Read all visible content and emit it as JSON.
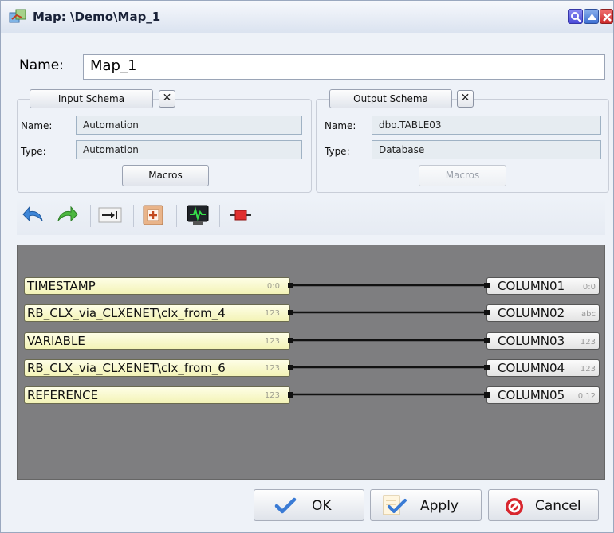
{
  "window": {
    "title": "Map: \\Demo\\Map_1",
    "icon": "map-icon"
  },
  "name_field": {
    "label": "Name:",
    "value": "Map_1"
  },
  "input_schema": {
    "button_label": "Input Schema",
    "name_label": "Name:",
    "name_value": "Automation",
    "type_label": "Type:",
    "type_value": "Automation",
    "macros_label": "Macros"
  },
  "output_schema": {
    "button_label": "Output Schema",
    "name_label": "Name:",
    "name_value": "dbo.TABLE03",
    "type_label": "Type:",
    "type_value": "Database",
    "macros_label": "Macros"
  },
  "toolbar": {
    "icons": [
      "undo-icon",
      "redo-icon",
      "auto-map-icon",
      "add-icon",
      "monitor-icon",
      "disconnect-icon"
    ]
  },
  "mappings": [
    {
      "source": "TIMESTAMP",
      "source_type": "0:0",
      "target": "COLUMN01",
      "target_type": "0:0"
    },
    {
      "source": "RB_CLX_via_CLXENET\\clx_from_4",
      "source_type": "123",
      "target": "COLUMN02",
      "target_type": "abc"
    },
    {
      "source": "VARIABLE",
      "source_type": "123",
      "target": "COLUMN03",
      "target_type": "123"
    },
    {
      "source": "RB_CLX_via_CLXENET\\clx_from_6",
      "source_type": "123",
      "target": "COLUMN04",
      "target_type": "123"
    },
    {
      "source": "REFERENCE",
      "source_type": "123",
      "target": "COLUMN05",
      "target_type": "0.12"
    }
  ],
  "buttons": {
    "ok": "OK",
    "apply": "Apply",
    "cancel": "Cancel"
  },
  "colors": {
    "canvas": "#7e7e80",
    "source_node": "#f6f6c0",
    "target_node": "#eeeeee",
    "cancel_red": "#d8262e",
    "check_blue": "#3a7bd5"
  }
}
